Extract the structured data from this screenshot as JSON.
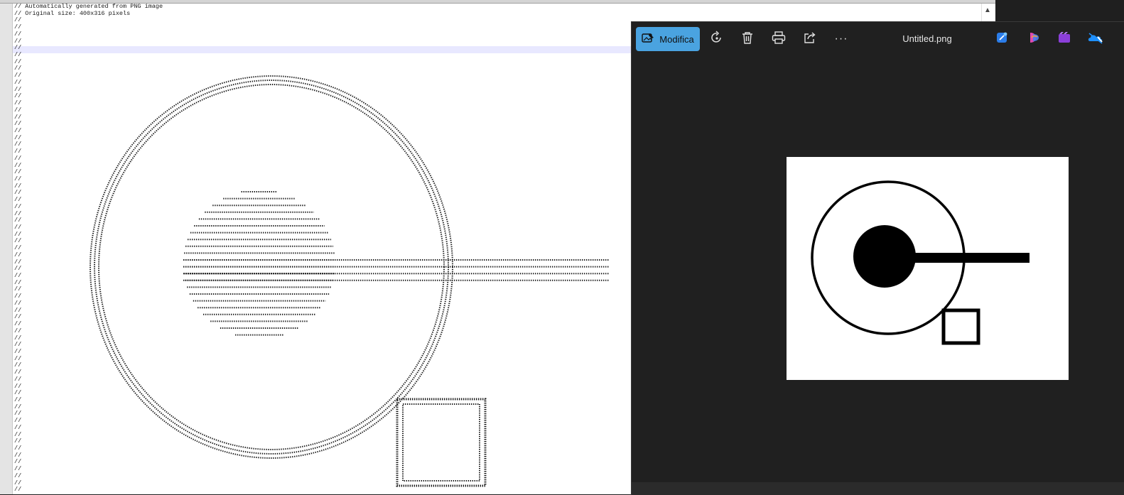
{
  "editor": {
    "header_lines": [
      "// Automatically generated from PNG image",
      "// Original size: 400x316 pixels"
    ],
    "comment_marker": "//",
    "scroll_up_glyph": "▲"
  },
  "viewer": {
    "edit_button_label": "Modifica",
    "file_name": "Untitled.png",
    "toolbar_icons": [
      "edit-image-icon",
      "rotate-icon",
      "delete-icon",
      "print-icon",
      "share-icon",
      "more-options-icon"
    ],
    "app_icons": [
      "designer-icon",
      "copilot-icon",
      "clipchamp-icon",
      "onedrive-icon"
    ],
    "more_label": "···"
  },
  "colors": {
    "accent": "#4aa3e0",
    "viewer_bg": "#202020",
    "editor_bg": "#ffffff",
    "line_highlight": "#e8e8ff"
  }
}
